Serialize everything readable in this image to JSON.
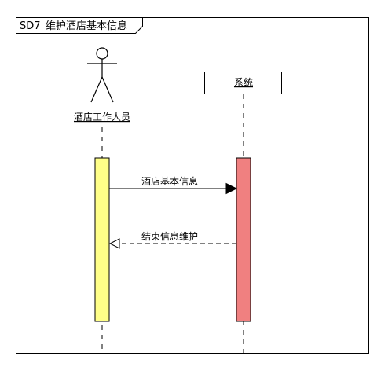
{
  "frame": {
    "title": "SD7_维护酒店基本信息"
  },
  "lifelines": {
    "actor": {
      "name": "酒店工作人员",
      "activation_color": "#ffff88"
    },
    "system": {
      "name": "系统",
      "activation_color": "#f08080"
    }
  },
  "messages": [
    {
      "label": "酒店基本信息",
      "kind": "synchronous",
      "from": "actor",
      "to": "system"
    },
    {
      "label": "结束信息维护",
      "kind": "return",
      "from": "system",
      "to": "actor"
    }
  ],
  "icons": {
    "actor": "stick-figure-icon",
    "sync_arrowhead": "filled-triangle-arrowhead-icon",
    "return_arrowhead": "open-arrowhead-icon"
  }
}
